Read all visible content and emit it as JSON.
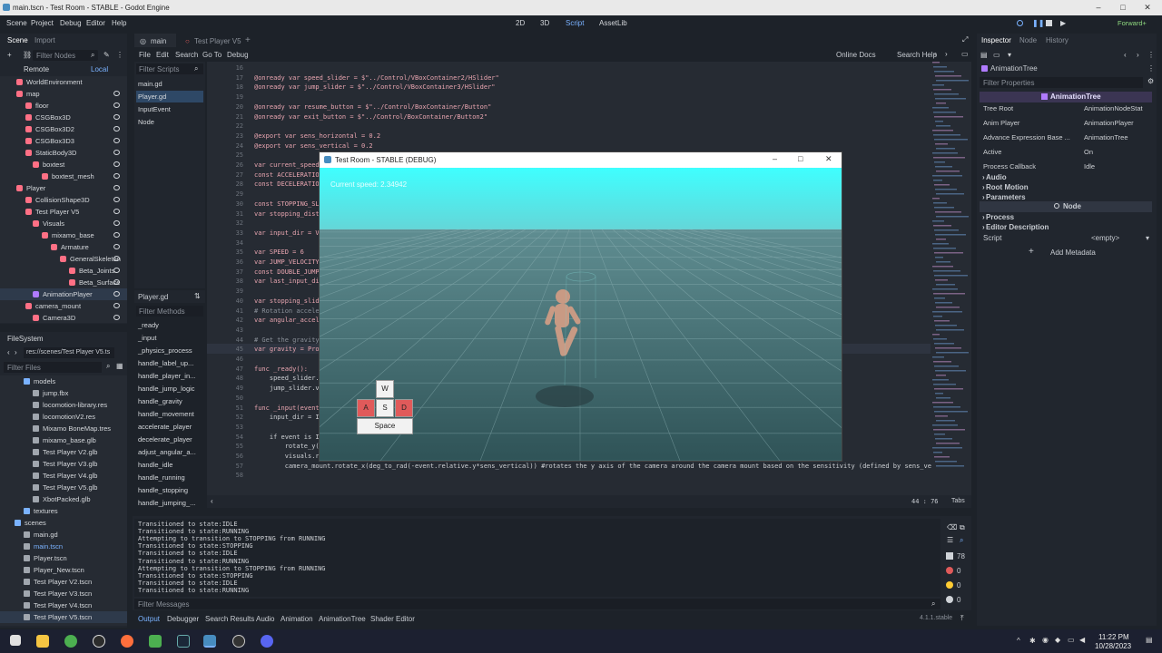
{
  "window": {
    "title": "main.tscn - Test Room - STABLE - Godot Engine"
  },
  "menubar": {
    "items": [
      "Scene",
      "Project",
      "Debug",
      "Editor",
      "Help"
    ],
    "modes": [
      "2D",
      "3D",
      "Script",
      "AssetLib"
    ],
    "renderer": "Forward+"
  },
  "scene_dock": {
    "tabs": [
      "Scene",
      "Import"
    ],
    "filter_placeholder": "Filter Nodes",
    "remote": "Remote",
    "local": "Local",
    "nodes": [
      "WorldEnvironment",
      "map",
      "floor",
      "CSGBox3D",
      "CSGBox3D2",
      "CSGBox3D3",
      "StaticBody3D",
      "boxtest",
      "boxtest_mesh",
      "Player",
      "CollisionShape3D",
      "Test Player V5",
      "Visuals",
      "mixamo_base",
      "Armature",
      "GeneralSkeleton",
      "Beta_Joints",
      "Beta_Surface",
      "AnimationPlayer",
      "camera_mount",
      "Camera3D"
    ]
  },
  "filesystem": {
    "title": "FileSystem",
    "path": "res://scenes/Test Player V5.ts",
    "filter_placeholder": "Filter Files",
    "items": [
      "models",
      "jump.fbx",
      "locomotion-library.res",
      "locomotionV2.res",
      "Mixamo BoneMap.tres",
      "mixamo_base.glb",
      "Test Player V2.glb",
      "Test Player V3.glb",
      "Test Player V4.glb",
      "Test Player V5.glb",
      "XbotPacked.glb",
      "textures",
      "scenes",
      "main.gd",
      "main.tscn",
      "Player.tscn",
      "Player_New.tscn",
      "Test Player V2.tscn",
      "Test Player V3.tscn",
      "Test Player V4.tscn",
      "Test Player V5.tscn"
    ]
  },
  "editor_tabs": [
    "main",
    "Test Player V5"
  ],
  "script_menu": [
    "File",
    "Edit",
    "Search",
    "Go To",
    "Debug"
  ],
  "script_toolbar": {
    "online_docs": "Online Docs",
    "search_help": "Search Help"
  },
  "script_list": {
    "filter_placeholder": "Filter Scripts",
    "items": [
      "main.gd",
      "Player.gd",
      "InputEvent",
      "Node"
    ],
    "current": "Player.gd",
    "methods_filter": "Filter Methods",
    "methods": [
      "_ready",
      "_input",
      "_physics_process",
      "handle_label_up...",
      "handle_player_in...",
      "handle_jump_logic",
      "handle_gravity",
      "handle_movement",
      "accelerate_player",
      "decelerate_player",
      "adjust_angular_a...",
      "handle_idle",
      "handle_running",
      "handle_stopping",
      "handle_jumping_..."
    ]
  },
  "code": [
    {
      "n": "16",
      "t": ""
    },
    {
      "n": "17",
      "t": "@onready var speed_slider = $\"../Control/VBoxContainer2/HSlider\""
    },
    {
      "n": "18",
      "t": "@onready var jump_slider = $\"../Control/VBoxContainer3/HSlider\""
    },
    {
      "n": "19",
      "t": ""
    },
    {
      "n": "20",
      "t": "@onready var resume_button = $\"../Control/BoxContainer/Button\""
    },
    {
      "n": "21",
      "t": "@onready var exit_button = $\"../Control/BoxContainer/Button2\""
    },
    {
      "n": "22",
      "t": ""
    },
    {
      "n": "23",
      "t": "@export var sens_horizontal = 0.2"
    },
    {
      "n": "24",
      "t": "@export var sens_vertical = 0.2"
    },
    {
      "n": "25",
      "t": ""
    },
    {
      "n": "26",
      "t": "var current_speed"
    },
    {
      "n": "27",
      "t": "const ACCELERATIO"
    },
    {
      "n": "28",
      "t": "const DECELERATIO"
    },
    {
      "n": "29",
      "t": ""
    },
    {
      "n": "30",
      "t": "const STOPPING_SL"
    },
    {
      "n": "31",
      "t": "var stopping_dist"
    },
    {
      "n": "32",
      "t": ""
    },
    {
      "n": "33",
      "t": "var input_dir = V"
    },
    {
      "n": "34",
      "t": ""
    },
    {
      "n": "35",
      "t": "var SPEED = 6"
    },
    {
      "n": "36",
      "t": "var JUMP_VELOCITY"
    },
    {
      "n": "37",
      "t": "const DOUBLE_JUMP"
    },
    {
      "n": "38",
      "t": "var last_input_di"
    },
    {
      "n": "39",
      "t": ""
    },
    {
      "n": "40",
      "t": "var stopping_slid"
    },
    {
      "n": "41",
      "t": "# Rotation accele"
    },
    {
      "n": "42",
      "t": "var angular_accel"
    },
    {
      "n": "43",
      "t": ""
    },
    {
      "n": "44",
      "t": "# Get the gravity"
    },
    {
      "n": "45",
      "t": "var gravity = Pro"
    },
    {
      "n": "46",
      "t": ""
    },
    {
      "n": "47",
      "t": "func _ready():"
    },
    {
      "n": "48",
      "t": "    speed_slider."
    },
    {
      "n": "49",
      "t": "    jump_slider.v"
    },
    {
      "n": "50",
      "t": ""
    },
    {
      "n": "51",
      "t": "func _input(event"
    },
    {
      "n": "52",
      "t": "    input_dir = I"
    },
    {
      "n": "53",
      "t": ""
    },
    {
      "n": "54",
      "t": "    if event is I"
    },
    {
      "n": "55",
      "t": "        rotate_y(                                                                                                   sens_horizontal)"
    },
    {
      "n": "56",
      "t": "        visuals.rotate_y(deg_to_rad(event.relative.x*sens_horizontal)) #prevents the player from moving direction when the camera rotates around them"
    },
    {
      "n": "57",
      "t": "        camera_mount.rotate_x(deg_to_rad(-event.relative.y*sens_vertical)) #rotates the y axis of the camera around the camera mount based on the sensitivity (defined by sens_ve"
    },
    {
      "n": "58",
      "t": ""
    }
  ],
  "status": {
    "position": "44 :   76",
    "indent": "Tabs"
  },
  "game_window": {
    "title": "Test Room - STABLE (DEBUG)",
    "speed": "Current speed: 2.34942",
    "keys": {
      "w": "W",
      "a": "A",
      "s": "S",
      "d": "D",
      "space": "Space"
    }
  },
  "output": {
    "lines": [
      "Transitioned to state:IDLE",
      "Transitioned to state:RUNNING",
      "Attempting to transition to STOPPING from RUNNING",
      "Transitioned to state:STOPPING",
      "Transitioned to state:IDLE",
      "Transitioned to state:RUNNING",
      "Attempting to transition to STOPPING from RUNNING",
      "Transitioned to state:STOPPING",
      "Transitioned to state:IDLE",
      "Transitioned to state:RUNNING"
    ],
    "filter_placeholder": "Filter Messages",
    "counts": [
      "78",
      "0",
      "0",
      "0"
    ],
    "version": "4.1.1.stable"
  },
  "bottom_tabs": [
    "Output",
    "Debugger",
    "Search Results",
    "Audio",
    "Animation",
    "AnimationTree",
    "Shader Editor"
  ],
  "inspector": {
    "tabs": [
      "Inspector",
      "Node",
      "History"
    ],
    "node": "AnimationTree",
    "filter_placeholder": "Filter Properties",
    "section": "AnimationTree",
    "props": [
      {
        "k": "Tree Root",
        "v": "AnimationNodeStat"
      },
      {
        "k": "Anim Player",
        "v": "AnimationPlayer"
      },
      {
        "k": "Advance Expression Base ...",
        "v": "AnimationTree"
      },
      {
        "k": "Active",
        "v": "On"
      },
      {
        "k": "Process Callback",
        "v": "Idle"
      }
    ],
    "groups": [
      "Audio",
      "Root Motion",
      "Parameters"
    ],
    "node_section": "Node",
    "groups2": [
      "Process",
      "Editor Description"
    ],
    "script_label": "Script",
    "script_value": "<empty>",
    "add_metadata": "Add Metadata"
  },
  "taskbar": {
    "time": "11:22 PM",
    "date": "10/28/2023"
  },
  "colors": {
    "accent": "#478cbf",
    "sky": "#3fffff",
    "ground": "#3a6267",
    "key_red": "#e05a5a"
  }
}
